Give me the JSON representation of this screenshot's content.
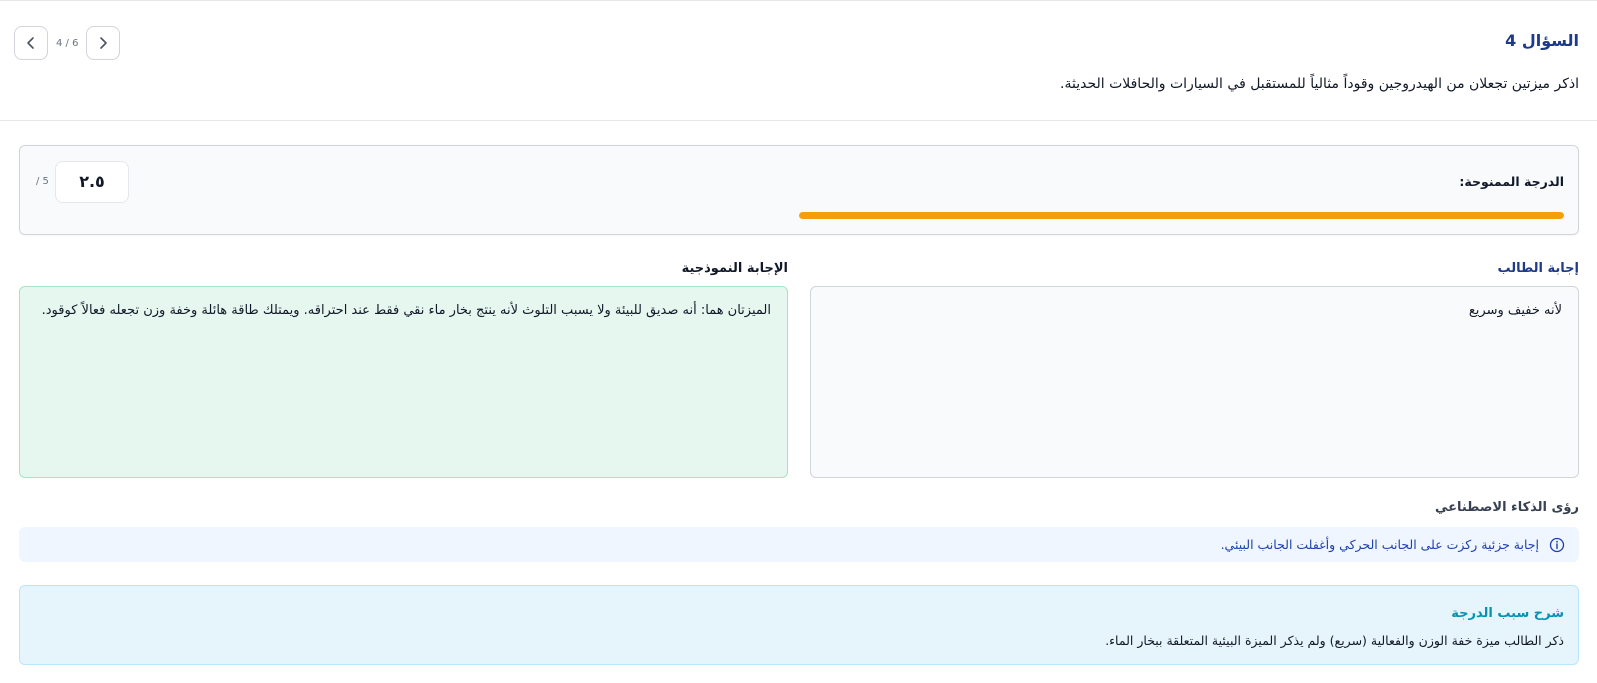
{
  "question": {
    "title": "السؤال 4",
    "text": "اذكر ميزتين تجعلان من الهيدروجين وقوداً مثالياً للمستقبل في السيارات والحافلات الحديثة.",
    "nav_count": "4 / 6"
  },
  "score": {
    "label": "الدرجة الممنوحة:",
    "value": "٢.٥",
    "max": "/ 5",
    "progress_fraction": 1.0,
    "progress_color": "#f59e0b"
  },
  "student": {
    "label": "إجابة الطالب",
    "answer": "لأنه خفيف وسريع"
  },
  "model": {
    "label": "الإجابة النموذجية",
    "answer": "الميزتان هما: أنه صديق للبيئة ولا يسبب التلوث لأنه ينتج بخار ماء نقي فقط عند احتراقه. ويمتلك طاقة هائلة وخفة وزن تجعله فعالاً كوقود."
  },
  "ai_insights": {
    "label": "رؤى الذكاء الاصطناعي",
    "icon": "info-icon",
    "text": "إجابة جزئية ركزت على الجانب الحركي وأغفلت الجانب البيئي."
  },
  "explanation": {
    "title": "شرح سبب الدرجة",
    "text": "ذكر الطالب ميزة خفة الوزن والفعالية (سريع) ولم يذكر الميزة البيئية المتعلقة ببخار الماء."
  },
  "colors": {
    "accent": "#1e3a8a",
    "progress": "#f59e0b",
    "model_bg": "#e6f7ef",
    "explain_bg": "#e6f4fb"
  }
}
